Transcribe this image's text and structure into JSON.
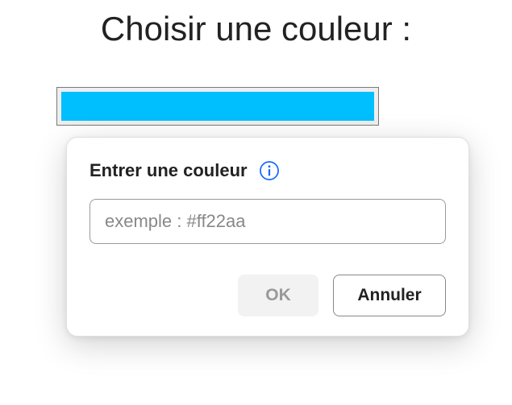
{
  "header": {
    "title": "Choisir une couleur :"
  },
  "swatch": {
    "color": "#00BFFF"
  },
  "popup": {
    "title": "Entrer une couleur",
    "input_placeholder": "exemple : #ff22aa",
    "input_value": "",
    "ok_label": "OK",
    "cancel_label": "Annuler"
  }
}
